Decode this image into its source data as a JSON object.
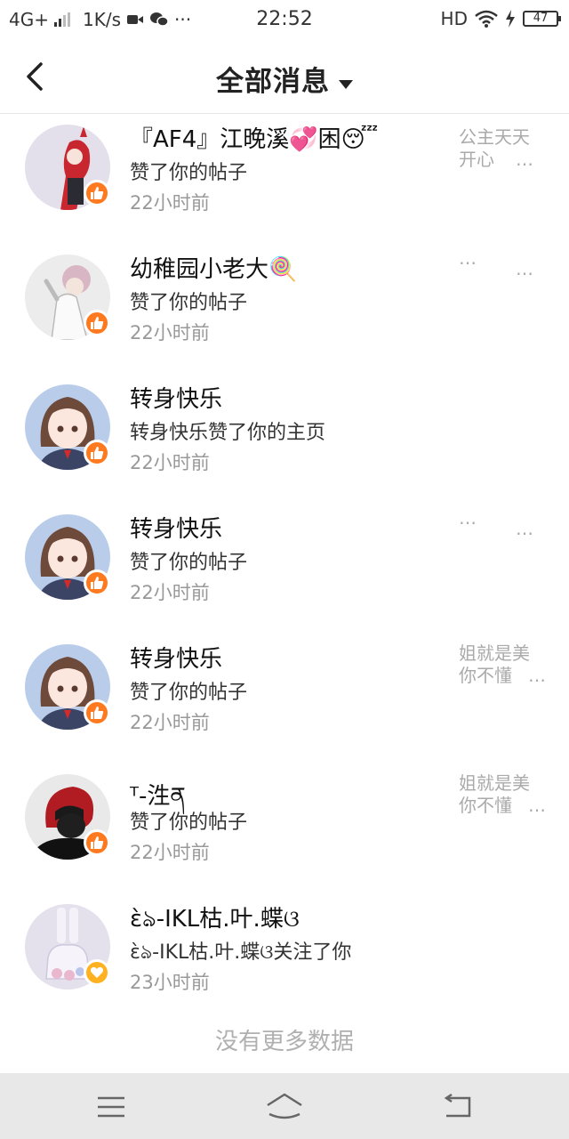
{
  "status_bar": {
    "network": "4G+",
    "speed": "1K/s",
    "more": "···",
    "time": "22:52",
    "hd": "HD",
    "battery": "47"
  },
  "header": {
    "title": "全部消息"
  },
  "colors": {
    "like_badge": "#ff7a1f",
    "follow_badge": "#ffb11f"
  },
  "notifications": [
    {
      "name": "『AF4』江晚溪💞困😴",
      "action": "赞了你的帖子",
      "time": "22小时前",
      "badge": "thumbs-up-icon",
      "preview": [
        "公主天天",
        "开心"
      ],
      "preview_more": "…"
    },
    {
      "name": "幼稚园小老大🍭",
      "action": "赞了你的帖子",
      "time": "22小时前",
      "badge": "thumbs-up-icon",
      "preview": [
        "…",
        ""
      ],
      "preview_more": "…"
    },
    {
      "name": "转身快乐",
      "action": "转身快乐赞了你的主页",
      "time": "22小时前",
      "badge": "thumbs-up-icon",
      "preview": [
        "",
        ""
      ],
      "preview_more": ""
    },
    {
      "name": "转身快乐",
      "action": "赞了你的帖子",
      "time": "22小时前",
      "badge": "thumbs-up-icon",
      "preview": [
        "…",
        ""
      ],
      "preview_more": "…"
    },
    {
      "name": "转身快乐",
      "action": "赞了你的帖子",
      "time": "22小时前",
      "badge": "thumbs-up-icon",
      "preview": [
        "姐就是美",
        "你不懂"
      ],
      "preview_more": "…"
    },
    {
      "name": "ᵀ-泩ན",
      "action": "赞了你的帖子",
      "time": "22小时前",
      "badge": "thumbs-up-icon",
      "preview": [
        "姐就是美",
        "你不懂"
      ],
      "preview_more": "…"
    },
    {
      "name": "ɛ̀ঌ-IKL枯.叶.蝶ଓ",
      "action": "ɛ̀ঌ-IKL枯.叶.蝶ଓ关注了你",
      "time": "23小时前",
      "badge": "heart-icon",
      "preview": [
        "",
        ""
      ],
      "preview_more": ""
    }
  ],
  "footer": {
    "no_more": "没有更多数据"
  }
}
